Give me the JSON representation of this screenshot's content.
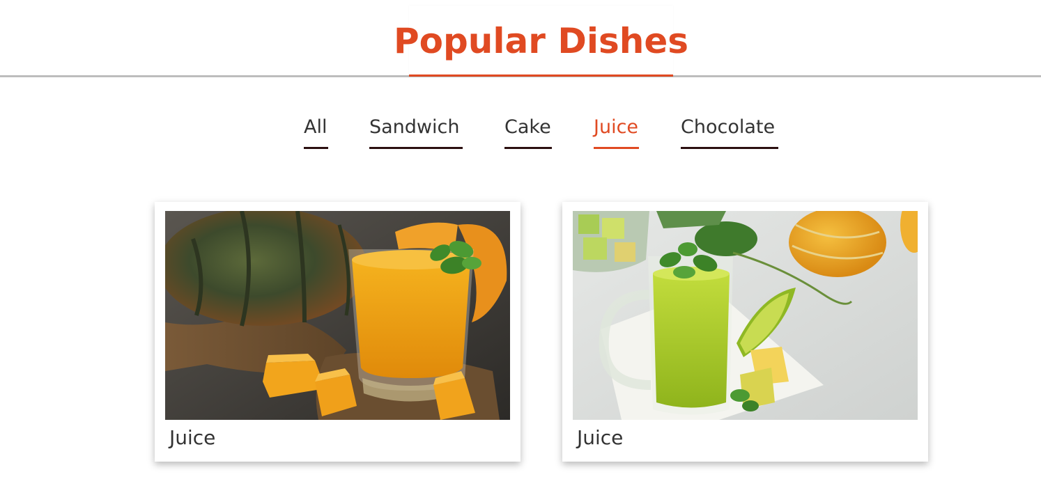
{
  "section": {
    "title": "Popular Dishes"
  },
  "filters": [
    {
      "label": "All",
      "active": false
    },
    {
      "label": "Sandwich",
      "active": false
    },
    {
      "label": "Cake",
      "active": false
    },
    {
      "label": "Juice",
      "active": true
    },
    {
      "label": "Chocolate",
      "active": false
    }
  ],
  "cards": [
    {
      "label": "Juice",
      "image": "pumpkin-juice-photo"
    },
    {
      "label": "Juice",
      "image": "melon-juice-photo"
    }
  ],
  "colors": {
    "accent": "#e04a22",
    "text": "#333333",
    "underline": "#2b0f10",
    "rule": "#bdbdbd"
  }
}
